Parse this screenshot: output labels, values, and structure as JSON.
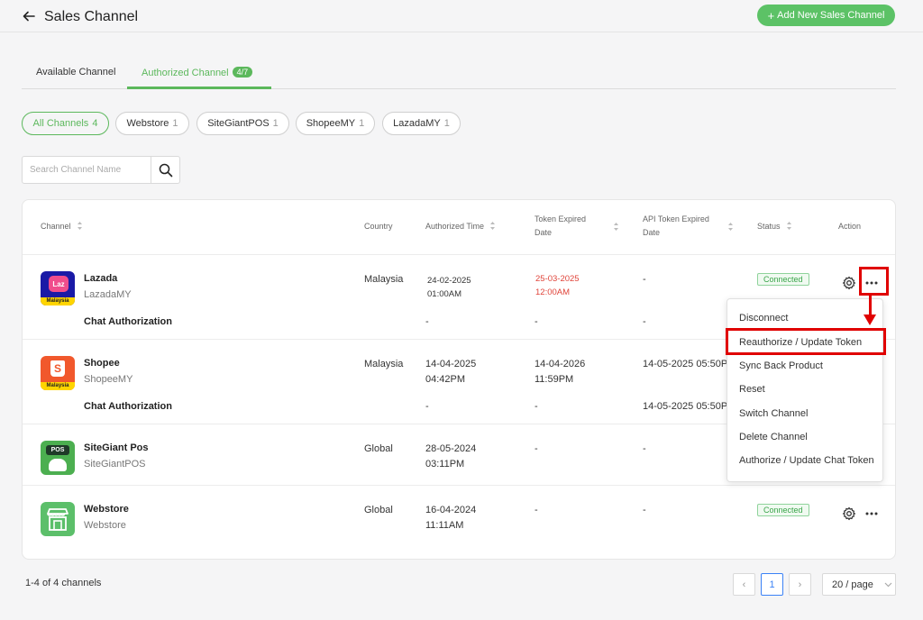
{
  "header": {
    "title": "Sales Channel",
    "add_button": "Add New Sales Channel"
  },
  "tabs": [
    {
      "label": "Available Channel"
    },
    {
      "label": "Authorized Channel",
      "badge": "4/7"
    }
  ],
  "filters": [
    {
      "label": "All Channels",
      "count": "4"
    },
    {
      "label": "Webstore",
      "count": "1"
    },
    {
      "label": "SiteGiantPOS",
      "count": "1"
    },
    {
      "label": "ShopeeMY",
      "count": "1"
    },
    {
      "label": "LazadaMY",
      "count": "1"
    }
  ],
  "search": {
    "placeholder": "Search Channel Name"
  },
  "table": {
    "headers": {
      "channel": "Channel",
      "country": "Country",
      "authorized_time": "Authorized Time",
      "token_expired_1": "Token Expired",
      "token_expired_2": "Date",
      "api_token_1": "API Token Expired",
      "api_token_2": "Date",
      "status": "Status",
      "action": "Action"
    },
    "rows": [
      {
        "name": "Lazada",
        "sub": "LazadaMY",
        "country": "Malaysia",
        "auth_date": "24-02-2025",
        "auth_time": "01:00AM",
        "token_date": "25-03-2025",
        "token_time": "12:00AM",
        "api_token": "-",
        "status": "Connected",
        "chat_label": "Chat Authorization",
        "chat_auth": "-",
        "chat_token": "-",
        "chat_api": "-",
        "logo_text": "Laz",
        "logo_caption": "Malaysia"
      },
      {
        "name": "Shopee",
        "sub": "ShopeeMY",
        "country": "Malaysia",
        "auth_date": "14-04-2025",
        "auth_time": "04:42PM",
        "token_date": "14-04-2026",
        "token_time": "11:59PM",
        "api_token": "14-05-2025 05:50PM",
        "chat_label": "Chat Authorization",
        "chat_auth": "-",
        "chat_token": "-",
        "chat_api": "14-05-2025 05:50PM",
        "logo_text": "S",
        "logo_caption": "Malaysia"
      },
      {
        "name": "SiteGiant Pos",
        "sub": "SiteGiantPOS",
        "country": "Global",
        "auth_date": "28-05-2024",
        "auth_time": "03:11PM",
        "token": "-",
        "api_token": "-",
        "logo_text": "POS"
      },
      {
        "name": "Webstore",
        "sub": "Webstore",
        "country": "Global",
        "auth_date": "16-04-2024",
        "auth_time": "11:11AM",
        "token": "-",
        "api_token": "-",
        "status": "Connected"
      }
    ]
  },
  "menu": {
    "items": [
      "Disconnect",
      "Reauthorize / Update Token",
      "Sync Back Product",
      "Reset",
      "Switch Channel",
      "Delete Channel",
      "Authorize / Update Chat Token"
    ]
  },
  "footer": {
    "summary": "1-4 of 4 channels",
    "current_page": "1",
    "per_page": "20 / page"
  },
  "colors": {
    "accent": "#5cb85c",
    "button": "#5cc266",
    "highlight": "#e00000",
    "expired": "#e0443a",
    "lazada": "#1a1aa6",
    "shopee": "#f1582c",
    "sitegiant": "#4caf50",
    "webstore": "#5cbf6a"
  }
}
